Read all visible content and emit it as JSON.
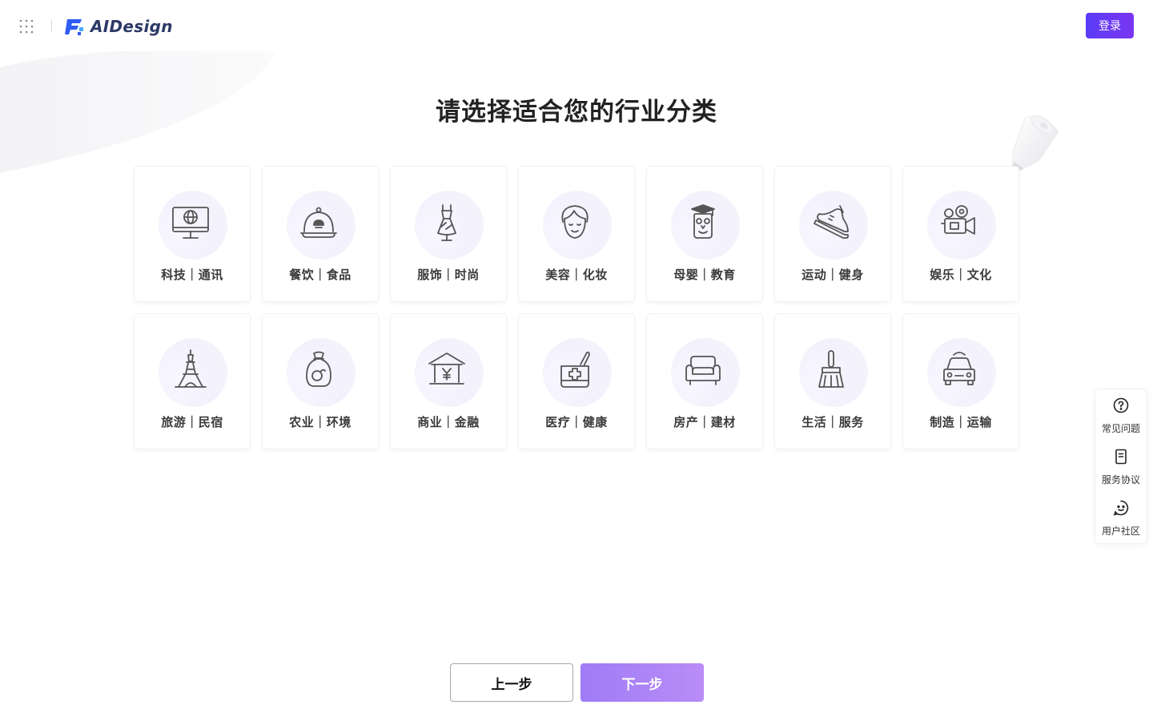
{
  "header": {
    "logo_text": "AIDesign",
    "login_label": "登录",
    "brand_color": "#5b3cf7"
  },
  "page": {
    "title": "请选择适合您的行业分类"
  },
  "categories": [
    {
      "label": "科技｜通讯",
      "icon": "computer-globe-icon"
    },
    {
      "label": "餐饮｜食品",
      "icon": "food-cloche-icon"
    },
    {
      "label": "服饰｜时尚",
      "icon": "dress-icon"
    },
    {
      "label": "美容｜化妆",
      "icon": "face-icon"
    },
    {
      "label": "母婴｜教育",
      "icon": "owl-graduate-icon"
    },
    {
      "label": "运动｜健身",
      "icon": "sneaker-icon"
    },
    {
      "label": "娱乐｜文化",
      "icon": "video-camera-icon"
    },
    {
      "label": "旅游｜民宿",
      "icon": "eiffel-tower-icon"
    },
    {
      "label": "农业｜环境",
      "icon": "grain-sack-icon"
    },
    {
      "label": "商业｜金融",
      "icon": "bank-icon"
    },
    {
      "label": "医疗｜健康",
      "icon": "medical-kit-icon"
    },
    {
      "label": "房产｜建材",
      "icon": "armchair-icon"
    },
    {
      "label": "生活｜服务",
      "icon": "broom-icon"
    },
    {
      "label": "制造｜运输",
      "icon": "car-icon"
    }
  ],
  "side_panel": {
    "items": [
      {
        "label": "常见问题",
        "icon": "question-circle-icon"
      },
      {
        "label": "服务协议",
        "icon": "document-icon"
      },
      {
        "label": "用户社区",
        "icon": "smile-chat-icon"
      }
    ]
  },
  "footer": {
    "prev_label": "上一步",
    "next_label": "下一步"
  }
}
